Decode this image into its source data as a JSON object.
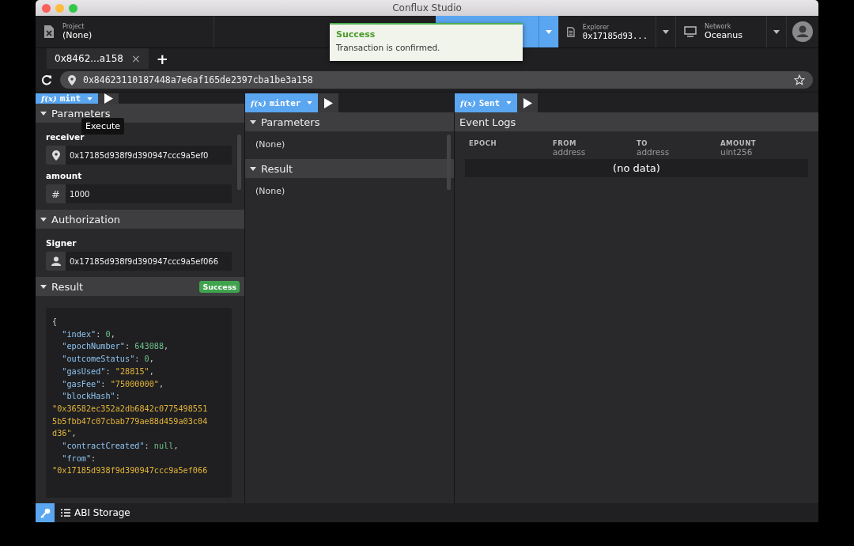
{
  "window": {
    "title": "Conflux Studio"
  },
  "header": {
    "project": {
      "label": "Project",
      "value": "(None)"
    },
    "explorer": {
      "label": "Explorer",
      "value": "0x17185d93..."
    },
    "network": {
      "label": "Network",
      "value": "Oceanus"
    }
  },
  "toast": {
    "title": "Success",
    "message": "Transaction is confirmed."
  },
  "tabs": [
    {
      "label": "0x8462...a158",
      "selected": true,
      "close": "×"
    }
  ],
  "add_tab": "+",
  "address_bar": {
    "value": "0x84623110187448a7e6af165de2397cba1be3a158"
  },
  "panels": [
    {
      "fx": "f(x)",
      "function": "mint",
      "tooltip": "Execute",
      "sections": [
        {
          "kind": "fields",
          "title": "Parameters",
          "fields": [
            {
              "label": "receiver",
              "kind": "address",
              "value": "0x17185d938f9d390947ccc9a5ef0"
            },
            {
              "label": "amount",
              "kind": "number",
              "symbol": "#",
              "value": "1000"
            }
          ]
        },
        {
          "kind": "fields",
          "title": "Authorization",
          "fields": [
            {
              "label": "Signer",
              "kind": "signer",
              "value": "0x17185d938f9d390947ccc9a5ef066"
            }
          ]
        },
        {
          "kind": "code",
          "title": "Result",
          "badge": "Success",
          "lines": [
            [
              {
                "t": "{",
                "kind": "p"
              }
            ],
            [
              {
                "t": "  \"index\"",
                "kind": "key"
              },
              {
                "t": ": ",
                "kind": "p"
              },
              {
                "t": "0",
                "kind": "num"
              },
              {
                "t": ",",
                "kind": "p"
              }
            ],
            [
              {
                "t": "  \"epochNumber\"",
                "kind": "key"
              },
              {
                "t": ": ",
                "kind": "p"
              },
              {
                "t": "643088",
                "kind": "num"
              },
              {
                "t": ",",
                "kind": "p"
              }
            ],
            [
              {
                "t": "  \"outcomeStatus\"",
                "kind": "key"
              },
              {
                "t": ": ",
                "kind": "p"
              },
              {
                "t": "0",
                "kind": "num"
              },
              {
                "t": ",",
                "kind": "p"
              }
            ],
            [
              {
                "t": "  \"gasUsed\"",
                "kind": "key"
              },
              {
                "t": ": ",
                "kind": "p"
              },
              {
                "t": "\"28815\"",
                "kind": "str"
              },
              {
                "t": ",",
                "kind": "p"
              }
            ],
            [
              {
                "t": "  \"gasFee\"",
                "kind": "key"
              },
              {
                "t": ": ",
                "kind": "p"
              },
              {
                "t": "\"75000000\"",
                "kind": "str"
              },
              {
                "t": ",",
                "kind": "p"
              }
            ],
            [
              {
                "t": "  \"blockHash\"",
                "kind": "key"
              },
              {
                "t": ":",
                "kind": "p"
              }
            ],
            [
              {
                "t": "\"0x36582ec352a2db6842c0775498551",
                "kind": "str"
              }
            ],
            [
              {
                "t": "5b5fbb47c07cbab779ae88d459a03c04",
                "kind": "str"
              }
            ],
            [
              {
                "t": "d36\"",
                "kind": "str"
              },
              {
                "t": ",",
                "kind": "p"
              }
            ],
            [
              {
                "t": "  \"contractCreated\"",
                "kind": "key"
              },
              {
                "t": ": ",
                "kind": "p"
              },
              {
                "t": "null",
                "kind": "lit"
              },
              {
                "t": ",",
                "kind": "p"
              }
            ],
            [
              {
                "t": "  \"from\"",
                "kind": "key"
              },
              {
                "t": ":",
                "kind": "p"
              }
            ],
            [
              {
                "t": "\"0x17185d938f9d390947ccc9a5ef066",
                "kind": "str"
              }
            ]
          ]
        }
      ]
    },
    {
      "fx": "f(x)",
      "function": "minter",
      "sections": [
        {
          "kind": "text",
          "title": "Parameters",
          "text": "(None)"
        },
        {
          "kind": "text",
          "title": "Result",
          "text": "(None)"
        }
      ]
    },
    {
      "fx": "f(x)",
      "function": "Sent",
      "sections": [
        {
          "kind": "table",
          "title": "Event Logs",
          "columns": [
            {
              "name": "EPOCH"
            },
            {
              "name": "FROM",
              "type": "address"
            },
            {
              "name": "TO",
              "type": "address"
            },
            {
              "name": "AMOUNT",
              "type": "uint256"
            }
          ],
          "empty": "(no data)"
        }
      ]
    }
  ],
  "status_bar": {
    "label": "ABI Storage"
  }
}
